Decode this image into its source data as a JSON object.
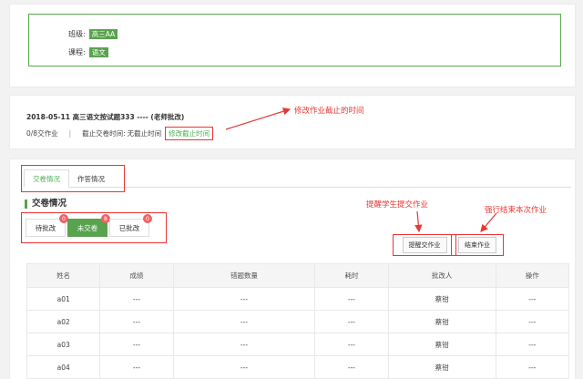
{
  "class_info": {
    "class_label": "班级:",
    "class_value": "高三AA",
    "course_label": "课程:",
    "course_value": "语文"
  },
  "exam": {
    "title": "2018-05-11 高三语文按试题333 ---- (老师批改)",
    "progress": "0/8交作业",
    "separator": "|",
    "deadline_label": "截止交卷时间:",
    "deadline_value": "无截止时间",
    "modify_link": "修改截止时间"
  },
  "annotations": {
    "modify_deadline": "修改作业截止的时间",
    "remind_students": "提醒学生提交作业",
    "force_end": "强行结束本次作业"
  },
  "tabs": [
    {
      "label": "交卷情况"
    },
    {
      "label": "作答情况"
    }
  ],
  "section_title": "交卷情况",
  "filters": [
    {
      "label": "待批改",
      "count": "0"
    },
    {
      "label": "未交卷",
      "count": "8"
    },
    {
      "label": "已批改",
      "count": "0"
    }
  ],
  "actions": {
    "remind": "提醒交作业",
    "end": "结束作业"
  },
  "table": {
    "headers": [
      "姓名",
      "成绩",
      "错题数量",
      "耗时",
      "批改人",
      "操作"
    ],
    "rows": [
      [
        "a01",
        "---",
        "---",
        "---",
        "蔡钳",
        "---"
      ],
      [
        "a02",
        "---",
        "---",
        "---",
        "蔡钳",
        "---"
      ],
      [
        "a03",
        "---",
        "---",
        "---",
        "蔡钳",
        "---"
      ],
      [
        "a04",
        "---",
        "---",
        "---",
        "蔡钳",
        "---"
      ]
    ]
  },
  "colors": {
    "accent_green": "#59a34f",
    "annotation_red": "#e53935",
    "badge_red": "#f06262"
  }
}
